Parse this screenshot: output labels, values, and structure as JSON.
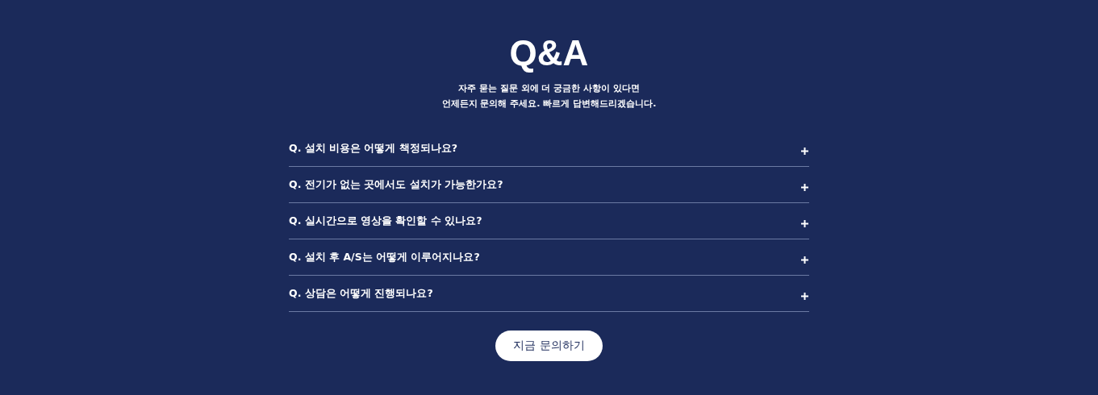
{
  "title": "Q&A",
  "subtitle_lines": [
    "자주 묻는 질문 외에 더 궁금한 사항이 있다면",
    "언제든지 문의해 주세요. 빠르게 답변해드리겠습니다."
  ],
  "faq": [
    {
      "question": "Q. 설치 비용은 어떻게 책정되나요?",
      "expanded": false
    },
    {
      "question": "Q. 전기가 없는 곳에서도 설치가 가능한가요?",
      "expanded": false
    },
    {
      "question": "Q. 실시간으로 영상을 확인할 수 있나요?",
      "expanded": false
    },
    {
      "question": "Q. 설치 후 A/S는 어떻게 이루어지나요?",
      "expanded": false
    },
    {
      "question": "Q. 상담은 어떻게 진행되나요?",
      "expanded": false
    }
  ],
  "button": "지금 문의하기"
}
